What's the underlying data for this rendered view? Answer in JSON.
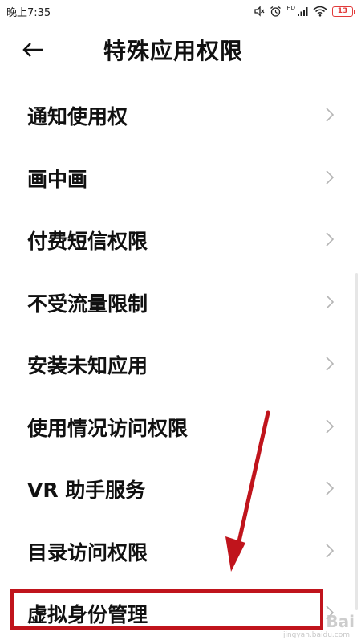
{
  "status_bar": {
    "time": "晚上7:35",
    "hd_label": "HD",
    "battery_level": "13",
    "icons": [
      "mute-icon",
      "alarm-icon",
      "signal-icon",
      "wifi-icon",
      "battery-icon"
    ],
    "battery_color": "#e23b3b"
  },
  "header": {
    "back_icon": "back-arrow-icon",
    "title": "特殊应用权限"
  },
  "list": {
    "items": [
      {
        "label": "通知使用权",
        "icon": "chevron-right-icon"
      },
      {
        "label": "画中画",
        "icon": "chevron-right-icon"
      },
      {
        "label": "付费短信权限",
        "icon": "chevron-right-icon"
      },
      {
        "label": "不受流量限制",
        "icon": "chevron-right-icon"
      },
      {
        "label": "安装未知应用",
        "icon": "chevron-right-icon"
      },
      {
        "label": "使用情况访问权限",
        "icon": "chevron-right-icon"
      },
      {
        "label": "VR 助手服务",
        "icon": "chevron-right-icon"
      },
      {
        "label": "目录访问权限",
        "icon": "chevron-right-icon"
      },
      {
        "label": "虚拟身份管理",
        "icon": "chevron-right-icon"
      }
    ]
  },
  "annotation": {
    "highlight_color": "#c0141c",
    "arrow_color": "#c0141c"
  },
  "watermark": {
    "text": "Bai",
    "sub_text": "jingyan.baidu.com"
  }
}
